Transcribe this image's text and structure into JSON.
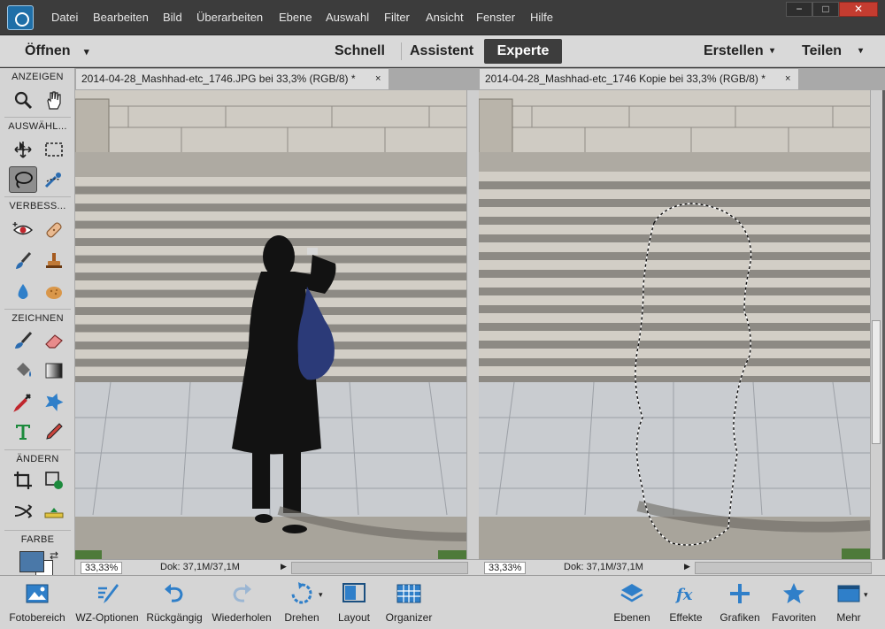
{
  "menu": {
    "items": [
      "Datei",
      "Bearbeiten",
      "Bild",
      "Überarbeiten",
      "Ebene",
      "Auswahl",
      "Filter",
      "Ansicht",
      "Fenster",
      "Hilfe"
    ],
    "window_controls": [
      "−",
      "□",
      "✕"
    ]
  },
  "modebar": {
    "open_label": "Öffnen",
    "modes": [
      "Schnell",
      "Assistent",
      "Experte"
    ],
    "active_mode": "Experte",
    "create_label": "Erstellen",
    "share_label": "Teilen"
  },
  "toolbox": {
    "sections": [
      "ANZEIGEN",
      "AUSWÄHL...",
      "VERBESS...",
      "ZEICHNEN",
      "ÄNDERN",
      "FARBE"
    ],
    "tools": [
      "zoom",
      "hand",
      "move",
      "marquee",
      "lasso",
      "quick-selection",
      "red-eye",
      "spot-healing",
      "brush-smart",
      "clone-stamp",
      "blur",
      "sponge",
      "brush",
      "eraser",
      "paint-bucket",
      "gradient",
      "eyedropper",
      "custom-shape",
      "type",
      "pencil",
      "crop",
      "recompose",
      "content-aware-move",
      "straighten"
    ],
    "foreground_color": "#4a78a8",
    "background_color": "#ffffff"
  },
  "documents": [
    {
      "title": "2014-04-28_Mashhad-etc_1746.JPG bei 33,3% (RGB/8) *",
      "close": "×",
      "zoom": "33,33%",
      "doc_size": "Dok: 37,1M/37,1M"
    },
    {
      "title": "2014-04-28_Mashhad-etc_1746 Kopie bei 33,3% (RGB/8) *",
      "close": "×",
      "zoom": "33,33%",
      "doc_size": "Dok: 37,1M/37,1M"
    }
  ],
  "bottombar": {
    "left": [
      {
        "label": "Fotobereich",
        "icon": "photo-bin-icon"
      },
      {
        "label": "WZ-Optionen",
        "icon": "tool-options-icon"
      },
      {
        "label": "Rückgängig",
        "icon": "undo-icon"
      },
      {
        "label": "Wiederholen",
        "icon": "redo-icon"
      },
      {
        "label": "Drehen",
        "icon": "rotate-icon"
      },
      {
        "label": "Layout",
        "icon": "layout-icon"
      },
      {
        "label": "Organizer",
        "icon": "organizer-icon"
      }
    ],
    "right": [
      {
        "label": "Ebenen",
        "icon": "layers-icon"
      },
      {
        "label": "Effekte",
        "icon": "effects-icon"
      },
      {
        "label": "Grafiken",
        "icon": "graphics-icon"
      },
      {
        "label": "Favoriten",
        "icon": "favorites-icon"
      },
      {
        "label": "Mehr",
        "icon": "more-icon"
      }
    ]
  }
}
